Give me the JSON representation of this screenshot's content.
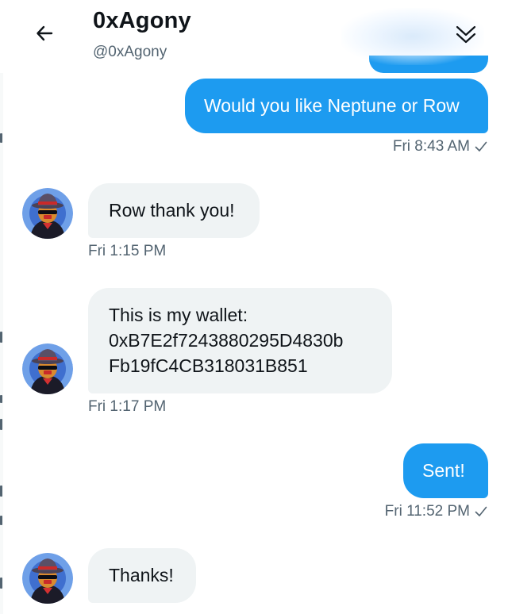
{
  "header": {
    "title": "0xAgony",
    "handle": "@0xAgony"
  },
  "icons": {
    "back": "arrow-left-icon",
    "collapse": "double-chevron-down-icon",
    "read_receipt": "checkmark-icon"
  },
  "colors": {
    "sent_bubble": "#1d9bf0",
    "received_bubble": "#eff3f4",
    "meta_text": "#536471"
  },
  "messages": [
    {
      "direction": "sent",
      "lines": [
        "Would you like Neptune or Row"
      ],
      "time": "Fri 8:43 AM",
      "read": true
    },
    {
      "direction": "received",
      "lines": [
        "Row thank you!"
      ],
      "time": "Fri 1:15 PM"
    },
    {
      "direction": "received",
      "lines": [
        "This is my wallet:",
        "0xB7E2f7243880295D4830b",
        "Fb19fC4CB318031B851"
      ],
      "time": "Fri 1:17 PM"
    },
    {
      "direction": "sent",
      "lines": [
        "Sent!"
      ],
      "time": "Fri 11:52 PM",
      "read": true
    },
    {
      "direction": "received",
      "lines": [
        "Thanks!"
      ]
    }
  ]
}
